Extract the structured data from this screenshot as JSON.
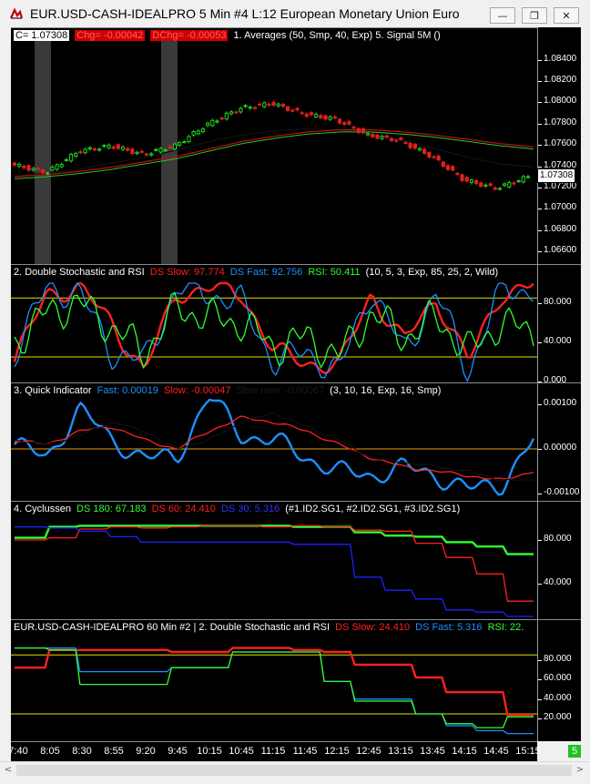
{
  "window": {
    "title": "EUR.USD-CASH-IDEALPRO  5 Min   #4  L:12  European Monetary Union Euro",
    "minimize_icon": "minimize-icon",
    "restore_icon": "restore-icon",
    "close_icon": "close-icon",
    "minimize_glyph": "—",
    "restore_glyph": "❐",
    "close_glyph": "✕"
  },
  "panels": [
    {
      "id": "price",
      "legend": [
        {
          "text": "C= 1.07308",
          "color": "#000000",
          "bg": "#ffffff"
        },
        {
          "text": "Chg= -0.00042",
          "color": "#ff3030",
          "bg": "#c00000"
        },
        {
          "text": "DChg= -0.00053",
          "color": "#ff3030",
          "bg": "#c00000"
        },
        {
          "text": "1. Averages   (50, Smp, 40, Exp)  5. Signal 5M   ()",
          "color": "#ffffff"
        }
      ],
      "ticks": [
        "1.08400",
        "1.08200",
        "1.08000",
        "1.07800",
        "1.07600",
        "1.07400",
        "1.07200",
        "1.07000",
        "1.06800",
        "1.06600"
      ],
      "last_price": "1.07308"
    },
    {
      "id": "stochastic",
      "legend": [
        {
          "text": "2. Double Stochastic and RSI",
          "color": "#ffffff"
        },
        {
          "text": "DS Slow: 97.774",
          "color": "#ff2020"
        },
        {
          "text": "DS Fast: 92.756",
          "color": "#1e90ff"
        },
        {
          "text": "RSI: 50.411",
          "color": "#30ff30"
        },
        {
          "text": "(10, 5, 3, Exp, 85, 25, 2, Wild)",
          "color": "#ffffff"
        }
      ],
      "ticks": [
        "80.000",
        "40.000",
        "0.000"
      ]
    },
    {
      "id": "quick",
      "legend": [
        {
          "text": "3. Quick Indicator",
          "color": "#ffffff"
        },
        {
          "text": "Fast: 0.00019",
          "color": "#1e90ff"
        },
        {
          "text": "Slow: -0.00047",
          "color": "#ff2020"
        },
        {
          "text": "Slow new: -0.00067",
          "color": "#202020"
        },
        {
          "text": "(3, 10, 16, Exp, 16, Smp)",
          "color": "#ffffff"
        }
      ],
      "ticks": [
        "0.00100",
        "0.00000",
        "-0.00100"
      ]
    },
    {
      "id": "cycles",
      "legend": [
        {
          "text": "4. Cyclussen",
          "color": "#ffffff"
        },
        {
          "text": "DS 180: 67.183",
          "color": "#30ff30"
        },
        {
          "text": "DS 60: 24.410",
          "color": "#ff2020"
        },
        {
          "text": "DS 30: 5.316",
          "color": "#2020ff"
        },
        {
          "text": "(#1.ID2.SG1, #2.ID2.SG1, #3.ID2.SG1)",
          "color": "#ffffff"
        }
      ],
      "ticks": [
        "80.000",
        "40.000"
      ]
    },
    {
      "id": "hourly",
      "legend": [
        {
          "text": "EUR.USD-CASH-IDEALPRO  60 Min   #2 | 2. Double Stochastic and RSI",
          "color": "#ffffff"
        },
        {
          "text": "DS Slow: 24.410",
          "color": "#ff2020"
        },
        {
          "text": "DS Fast: 5.316",
          "color": "#1e90ff"
        },
        {
          "text": "RSI: 22.",
          "color": "#30ff30"
        }
      ],
      "ticks": [
        "80.000",
        "60.000",
        "40.000",
        "20.000"
      ]
    }
  ],
  "time_axis": [
    "7:40",
    "8:05",
    "8:30",
    "8:55",
    "9:20",
    "9:45",
    "10:15",
    "10:45",
    "11:15",
    "11:45",
    "12:15",
    "12:45",
    "13:15",
    "13:45",
    "14:15",
    "14:45",
    "15:15"
  ],
  "status": {
    "counter": "5"
  },
  "scrollbar": {
    "left_glyph": "<",
    "right_glyph": ">"
  },
  "colors": {
    "background": "#000000",
    "bull_candle": "#20d020",
    "bear_candle": "#e02020",
    "ema": "#c01010",
    "sma": "#101010",
    "signal": "#30c030",
    "threshold": "#e8e000",
    "zero_line": "#e8a000"
  },
  "chart_data": [
    {
      "type": "candlestick",
      "title": "",
      "ylim": [
        1.0655,
        1.0855
      ],
      "x": [
        "7:40",
        "8:05",
        "8:30",
        "8:55",
        "9:20",
        "9:45",
        "10:15",
        "10:45",
        "11:15",
        "11:45",
        "12:15",
        "12:45",
        "13:15",
        "13:45",
        "14:15",
        "14:45",
        "15:15"
      ],
      "closes": [
        1.0742,
        1.0735,
        1.0755,
        1.076,
        1.0752,
        1.076,
        1.078,
        1.0795,
        1.08,
        1.079,
        1.0785,
        1.077,
        1.0765,
        1.075,
        1.0728,
        1.072,
        1.0731
      ],
      "series": [
        {
          "name": "1. Averages (50, Smp)",
          "values": [
            1.0732,
            1.0734,
            1.0738,
            1.0744,
            1.0749,
            1.0756,
            1.0764,
            1.077,
            1.0774,
            1.0776,
            1.0775,
            1.0771,
            1.0765,
            1.0757,
            1.0749,
            1.0743,
            1.074
          ]
        },
        {
          "name": "1. Averages (40, Exp)",
          "values": [
            1.0731,
            1.0733,
            1.0736,
            1.074,
            1.0745,
            1.075,
            1.0757,
            1.0764,
            1.0769,
            1.0773,
            1.0775,
            1.0775,
            1.0773,
            1.077,
            1.0766,
            1.0762,
            1.0759
          ]
        }
      ]
    },
    {
      "type": "line",
      "title": "2. Double Stochastic and RSI",
      "ylim": [
        0,
        100
      ],
      "thresholds": [
        85,
        25
      ],
      "series": [
        {
          "name": "DS Slow",
          "values": [
            20,
            90,
            95,
            60,
            10,
            90,
            95,
            90,
            30,
            20,
            15,
            90,
            40,
            85,
            20,
            90,
            98
          ]
        },
        {
          "name": "DS Fast",
          "values": [
            30,
            95,
            90,
            30,
            20,
            95,
            90,
            80,
            20,
            30,
            10,
            95,
            30,
            90,
            10,
            95,
            93
          ]
        },
        {
          "name": "RSI",
          "values": [
            40,
            70,
            80,
            55,
            30,
            75,
            65,
            60,
            35,
            45,
            25,
            70,
            45,
            65,
            30,
            60,
            50
          ]
        }
      ]
    },
    {
      "type": "line",
      "title": "3. Quick Indicator",
      "ylim": [
        -0.0011,
        0.0011
      ],
      "series": [
        {
          "name": "Fast",
          "values": [
            0.0001,
            -0.0002,
            0.0009,
            0.0002,
            -0.0002,
            -0.0002,
            0.0012,
            0.0003,
            0.0002,
            -0.0002,
            -0.0005,
            -0.0006,
            -0.0004,
            -0.0006,
            -0.0009,
            -0.0008,
            0.0002
          ]
        },
        {
          "name": "Slow",
          "values": [
            0.0002,
            0.0001,
            0.0004,
            0.0005,
            0.0002,
            0.0,
            0.0004,
            0.0007,
            0.0006,
            0.0004,
            0.0001,
            -0.0002,
            -0.0004,
            -0.0005,
            -0.0006,
            -0.0007,
            -0.0005
          ]
        },
        {
          "name": "Slow new",
          "values": [
            0.0002,
            0.0001,
            0.0003,
            0.0006,
            0.0004,
            0.0,
            0.0002,
            0.0006,
            0.0008,
            0.0005,
            0.0002,
            -0.0002,
            -0.0003,
            -0.0004,
            -0.0005,
            -0.0007,
            -0.0007
          ]
        }
      ]
    },
    {
      "type": "line",
      "title": "4. Cyclussen",
      "ylim": [
        10,
        100
      ],
      "series": [
        {
          "name": "DS 180",
          "values": [
            82,
            92,
            93,
            93,
            93,
            93,
            93,
            93,
            93,
            92,
            92,
            87,
            84,
            83,
            78,
            74,
            67
          ]
        },
        {
          "name": "DS 60",
          "values": [
            80,
            82,
            90,
            92,
            91,
            92,
            93,
            93,
            92,
            93,
            92,
            89,
            88,
            77,
            64,
            49,
            24
          ]
        },
        {
          "name": "DS 30",
          "values": [
            92,
            91,
            88,
            83,
            78,
            78,
            78,
            78,
            78,
            76,
            76,
            46,
            34,
            26,
            16,
            14,
            5
          ]
        }
      ]
    },
    {
      "type": "line",
      "title": "2. Double Stochastic and RSI",
      "ylim": [
        0,
        100
      ],
      "thresholds": [
        85,
        25
      ],
      "series": [
        {
          "name": "DS Slow",
          "values": [
            72,
            90,
            90,
            90,
            90,
            88,
            88,
            92,
            92,
            90,
            88,
            75,
            75,
            62,
            47,
            47,
            24
          ]
        },
        {
          "name": "DS Fast",
          "values": [
            92,
            92,
            68,
            68,
            68,
            72,
            72,
            88,
            88,
            88,
            58,
            40,
            40,
            25,
            13,
            8,
            5
          ]
        },
        {
          "name": "RSI",
          "values": [
            92,
            90,
            55,
            55,
            55,
            72,
            72,
            88,
            88,
            88,
            58,
            38,
            38,
            25,
            15,
            11,
            22
          ]
        }
      ]
    }
  ]
}
